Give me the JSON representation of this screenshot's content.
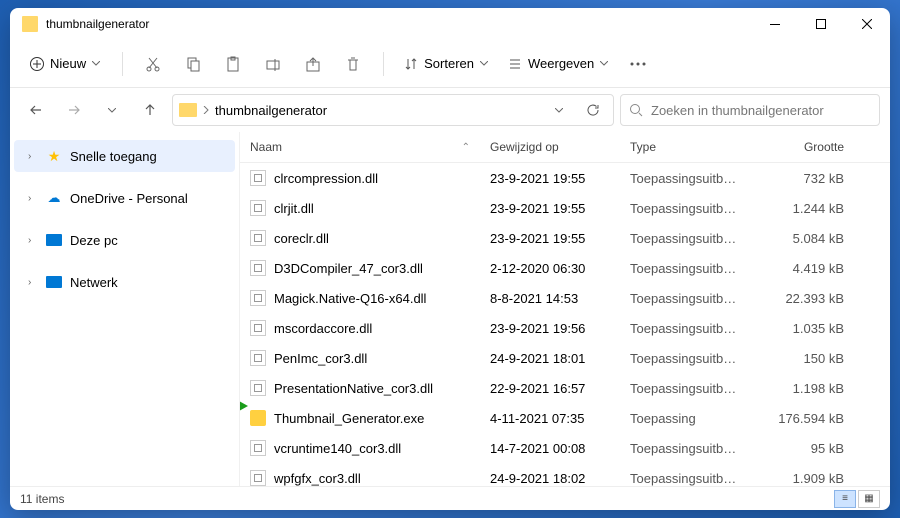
{
  "titlebar": {
    "title": "thumbnailgenerator"
  },
  "toolbar": {
    "new_label": "Nieuw",
    "sort_label": "Sorteren",
    "view_label": "Weergeven"
  },
  "address": {
    "path": "thumbnailgenerator"
  },
  "search": {
    "placeholder": "Zoeken in thumbnailgenerator"
  },
  "sidebar": {
    "items": [
      {
        "label": "Snelle toegang"
      },
      {
        "label": "OneDrive - Personal"
      },
      {
        "label": "Deze pc"
      },
      {
        "label": "Netwerk"
      }
    ]
  },
  "columns": {
    "name": "Naam",
    "date": "Gewijzigd op",
    "type": "Type",
    "size": "Grootte"
  },
  "files": [
    {
      "name": "clrcompression.dll",
      "date": "23-9-2021 19:55",
      "type": "Toepassingsuitbreidi...",
      "size": "732 kB",
      "icon": "dll"
    },
    {
      "name": "clrjit.dll",
      "date": "23-9-2021 19:55",
      "type": "Toepassingsuitbreidi...",
      "size": "1.244 kB",
      "icon": "dll"
    },
    {
      "name": "coreclr.dll",
      "date": "23-9-2021 19:55",
      "type": "Toepassingsuitbreidi...",
      "size": "5.084 kB",
      "icon": "dll"
    },
    {
      "name": "D3DCompiler_47_cor3.dll",
      "date": "2-12-2020 06:30",
      "type": "Toepassingsuitbreidi...",
      "size": "4.419 kB",
      "icon": "dll"
    },
    {
      "name": "Magick.Native-Q16-x64.dll",
      "date": "8-8-2021 14:53",
      "type": "Toepassingsuitbreidi...",
      "size": "22.393 kB",
      "icon": "dll"
    },
    {
      "name": "mscordaccore.dll",
      "date": "23-9-2021 19:56",
      "type": "Toepassingsuitbreidi...",
      "size": "1.035 kB",
      "icon": "dll"
    },
    {
      "name": "PenImc_cor3.dll",
      "date": "24-9-2021 18:01",
      "type": "Toepassingsuitbreidi...",
      "size": "150 kB",
      "icon": "dll"
    },
    {
      "name": "PresentationNative_cor3.dll",
      "date": "22-9-2021 16:57",
      "type": "Toepassingsuitbreidi...",
      "size": "1.198 kB",
      "icon": "dll"
    },
    {
      "name": "Thumbnail_Generator.exe",
      "date": "4-11-2021 07:35",
      "type": "Toepassing",
      "size": "176.594 kB",
      "icon": "exe"
    },
    {
      "name": "vcruntime140_cor3.dll",
      "date": "14-7-2021 00:08",
      "type": "Toepassingsuitbreidi...",
      "size": "95 kB",
      "icon": "dll"
    },
    {
      "name": "wpfgfx_cor3.dll",
      "date": "24-9-2021 18:02",
      "type": "Toepassingsuitbreidi...",
      "size": "1.909 kB",
      "icon": "dll"
    }
  ],
  "status": {
    "count": "11 items"
  }
}
